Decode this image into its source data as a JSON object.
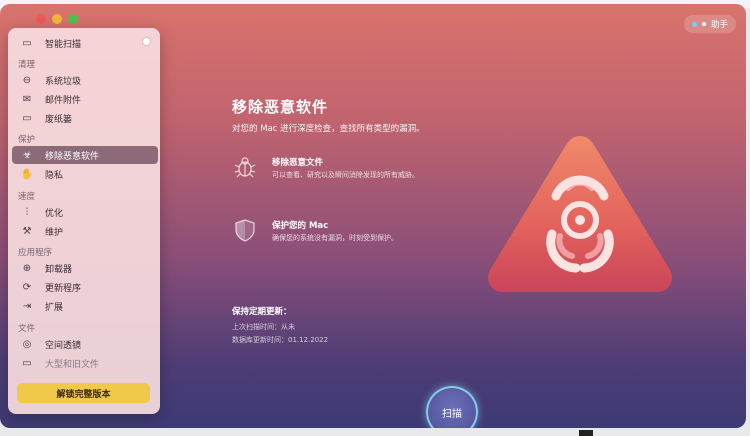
{
  "app": {
    "assistant_label": "助手"
  },
  "sidebar": {
    "top_item": {
      "label": "智能扫描",
      "icon": "monitor-icon"
    },
    "sections": [
      {
        "label": "清理"
      },
      {
        "label": "保护"
      },
      {
        "label": "速度"
      },
      {
        "label": "应用程序"
      },
      {
        "label": "文件"
      }
    ],
    "items": [
      {
        "label": "系统垃圾",
        "icon": "trash-icon"
      },
      {
        "label": "邮件附件",
        "icon": "mail-icon"
      },
      {
        "label": "废纸篓",
        "icon": "bin-icon"
      },
      {
        "label": "移除恶意软件",
        "icon": "biohazard-icon",
        "active": true
      },
      {
        "label": "隐私",
        "icon": "hand-icon"
      },
      {
        "label": "优化",
        "icon": "sliders-icon"
      },
      {
        "label": "维护",
        "icon": "wrench-icon"
      },
      {
        "label": "卸载器",
        "icon": "uninstaller-icon"
      },
      {
        "label": "更新程序",
        "icon": "updater-icon"
      },
      {
        "label": "扩展",
        "icon": "extensions-icon"
      },
      {
        "label": "空间透镜",
        "icon": "lens-icon"
      },
      {
        "label": "大型和旧文件",
        "icon": "folder-icon"
      }
    ],
    "unlock_button": "解锁完整版本"
  },
  "main": {
    "title": "移除恶意软件",
    "subtitle": "对您的 Mac 进行深度检查，查找所有类型的漏洞。",
    "features": [
      {
        "title": "移除恶意文件",
        "desc": "可以查看、研究以及瞬间消除发现的所有威胁。",
        "icon": "bug-icon"
      },
      {
        "title": "保护您的 Mac",
        "desc": "确保您的系统没有漏洞，时刻受到保护。",
        "icon": "shield-icon"
      }
    ],
    "keep_updated": {
      "title": "保持定期更新：",
      "last_scan": "上次扫描时间：从未",
      "db_update": "数据库更新时间：01.12.2022"
    },
    "scan_button": "扫描"
  }
}
